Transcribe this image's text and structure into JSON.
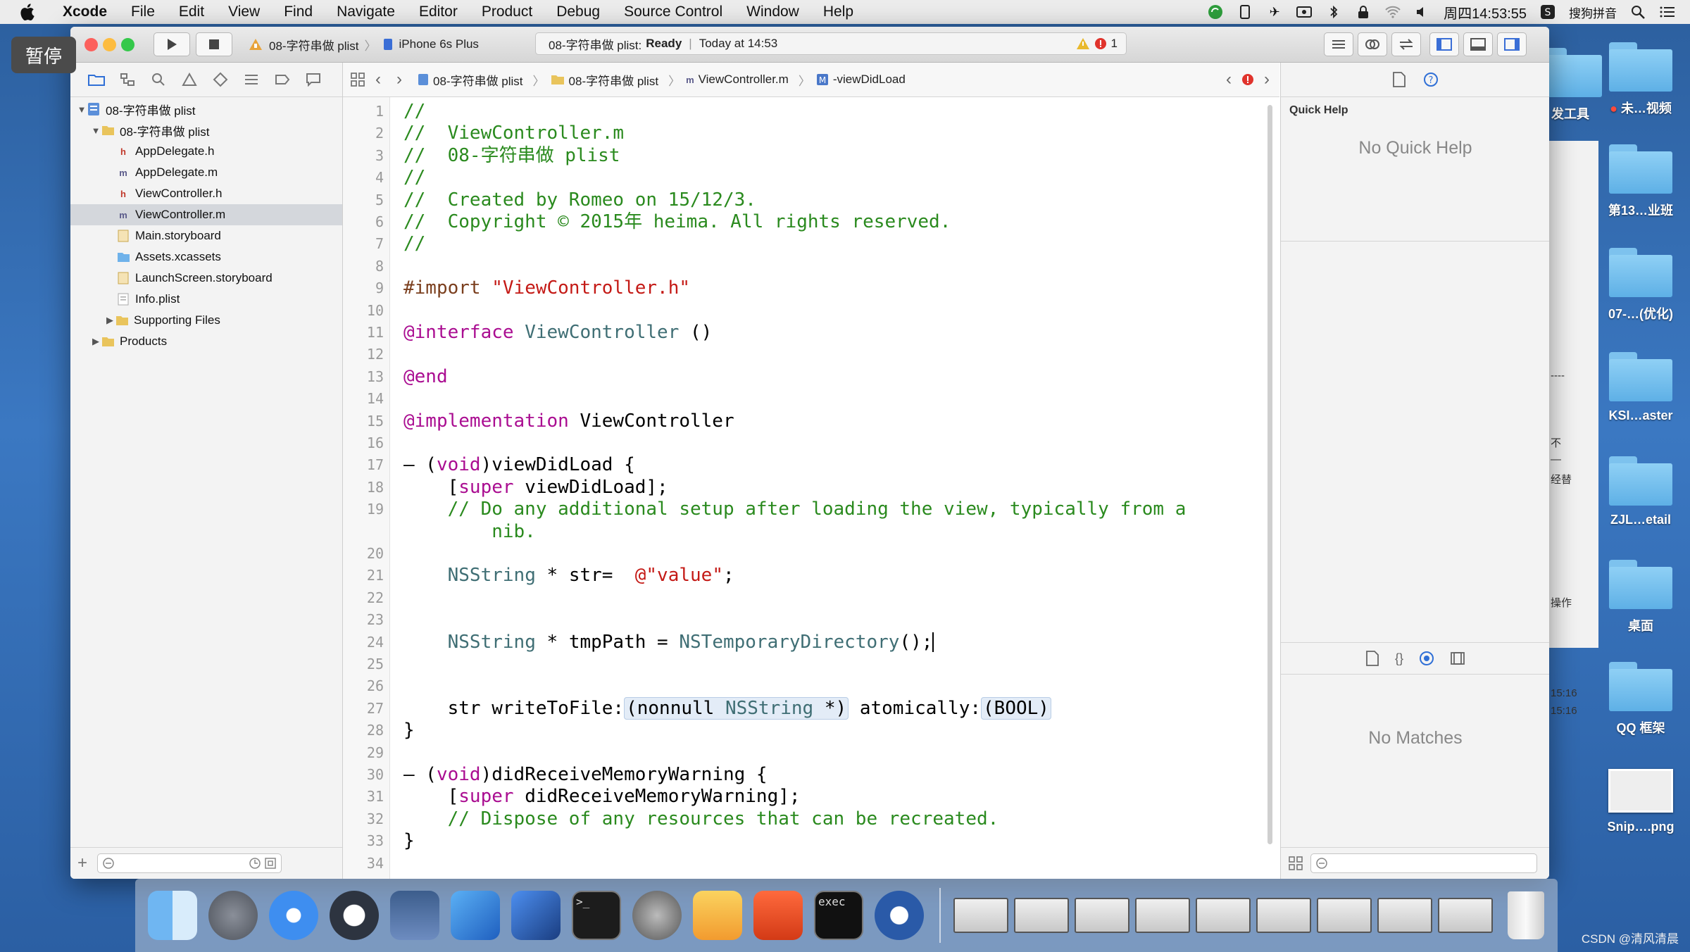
{
  "overlay": {
    "pause_label": "暂停"
  },
  "menubar": {
    "app_name": "Xcode",
    "items": [
      "File",
      "Edit",
      "View",
      "Find",
      "Navigate",
      "Editor",
      "Product",
      "Debug",
      "Source Control",
      "Window",
      "Help"
    ],
    "clock": "周四14:53:55",
    "ime": "搜狗拼音"
  },
  "toolbar": {
    "scheme_name": "08-字符串做 plist",
    "device": "iPhone 6s Plus",
    "status_project": "08-字符串做 plist:",
    "status_state": "Ready",
    "status_time": "Today at 14:53",
    "error_count": "1"
  },
  "navigator": {
    "project": "08-字符串做 plist",
    "group": "08-字符串做 plist",
    "files": [
      {
        "name": "AppDelegate.h",
        "kind": "h"
      },
      {
        "name": "AppDelegate.m",
        "kind": "m"
      },
      {
        "name": "ViewController.h",
        "kind": "h"
      },
      {
        "name": "ViewController.m",
        "kind": "m"
      },
      {
        "name": "Main.storyboard",
        "kind": "storyboard"
      },
      {
        "name": "Assets.xcassets",
        "kind": "assets"
      },
      {
        "name": "LaunchScreen.storyboard",
        "kind": "storyboard"
      },
      {
        "name": "Info.plist",
        "kind": "plist"
      }
    ],
    "supporting_files": "Supporting Files",
    "products": "Products"
  },
  "jumpbar": {
    "crumbs": [
      "08-字符串做 plist",
      "08-字符串做 plist",
      "ViewController.m",
      "-viewDidLoad"
    ]
  },
  "code_lines": [
    {
      "n": "1",
      "t": "//"
    },
    {
      "n": "2",
      "t": "//  ViewController.m"
    },
    {
      "n": "3",
      "t": "//  08-字符串做 plist"
    },
    {
      "n": "4",
      "t": "//"
    },
    {
      "n": "5",
      "t": "//  Created by Romeo on 15/12/3."
    },
    {
      "n": "6",
      "t": "//  Copyright © 2015年 heima. All rights reserved."
    },
    {
      "n": "7",
      "t": "//"
    },
    {
      "n": "8",
      "t": ""
    },
    {
      "n": "9",
      "t": "#import \"ViewController.h\""
    },
    {
      "n": "10",
      "t": ""
    },
    {
      "n": "11",
      "t": "@interface ViewController ()"
    },
    {
      "n": "12",
      "t": ""
    },
    {
      "n": "13",
      "t": "@end"
    },
    {
      "n": "14",
      "t": ""
    },
    {
      "n": "15",
      "t": "@implementation ViewController"
    },
    {
      "n": "16",
      "t": ""
    },
    {
      "n": "17",
      "t": "- (void)viewDidLoad {"
    },
    {
      "n": "18",
      "t": "    [super viewDidLoad];"
    },
    {
      "n": "19",
      "t": "    // Do any additional setup after loading the view, typically from a"
    },
    {
      "n": "",
      "t": "        nib."
    },
    {
      "n": "20",
      "t": ""
    },
    {
      "n": "21",
      "t": "    NSString * str=  @\"value\";"
    },
    {
      "n": "22",
      "t": ""
    },
    {
      "n": "23",
      "t": ""
    },
    {
      "n": "24",
      "t": "    NSString * tmpPath = NSTemporaryDirectory();"
    },
    {
      "n": "25",
      "t": ""
    },
    {
      "n": "26",
      "t": ""
    },
    {
      "n": "27",
      "t": "    str writeToFile:(nonnull NSString *) atomically:(BOOL)"
    },
    {
      "n": "28",
      "t": "}"
    },
    {
      "n": "29",
      "t": ""
    },
    {
      "n": "30",
      "t": "- (void)didReceiveMemoryWarning {"
    },
    {
      "n": "31",
      "t": "    [super didReceiveMemoryWarning];"
    },
    {
      "n": "32",
      "t": "    // Dispose of any resources that can be recreated."
    },
    {
      "n": "33",
      "t": "}"
    },
    {
      "n": "34",
      "t": ""
    }
  ],
  "inspector": {
    "title": "Quick Help",
    "empty_help": "No Quick Help",
    "no_matches": "No Matches"
  },
  "bg_window": {
    "texts": [
      "----",
      "不",
      "—",
      "经替",
      "操作",
      "15:16",
      "15:16"
    ]
  },
  "desktop": {
    "left_labels": [
      "发工具",
      "未…视频"
    ],
    "icons": [
      "第13…业班",
      "07-…(优化)",
      "KSI…aster",
      "ZJL…etail",
      "桌面",
      "QQ 框架",
      "Snip….png"
    ]
  },
  "dock": {
    "apps": [
      "finder-icon",
      "launchpad-icon",
      "safari-icon",
      "mouse-icon",
      "photo-slideshow-icon",
      "xcode-icon",
      "instruments-icon",
      "terminal-icon",
      "system-preferences-icon",
      "sketch-icon",
      "powerpoint-icon",
      "exec-terminal-icon",
      "quicktime-icon"
    ],
    "minimized_count": 9
  },
  "watermark": "CSDN @清风清晨",
  "colors": {
    "comment": "#2a8a1e",
    "keyword": "#aa0d91",
    "string": "#c41a16",
    "type": "#3f6e74",
    "preprocessor": "#7a3e1d"
  }
}
